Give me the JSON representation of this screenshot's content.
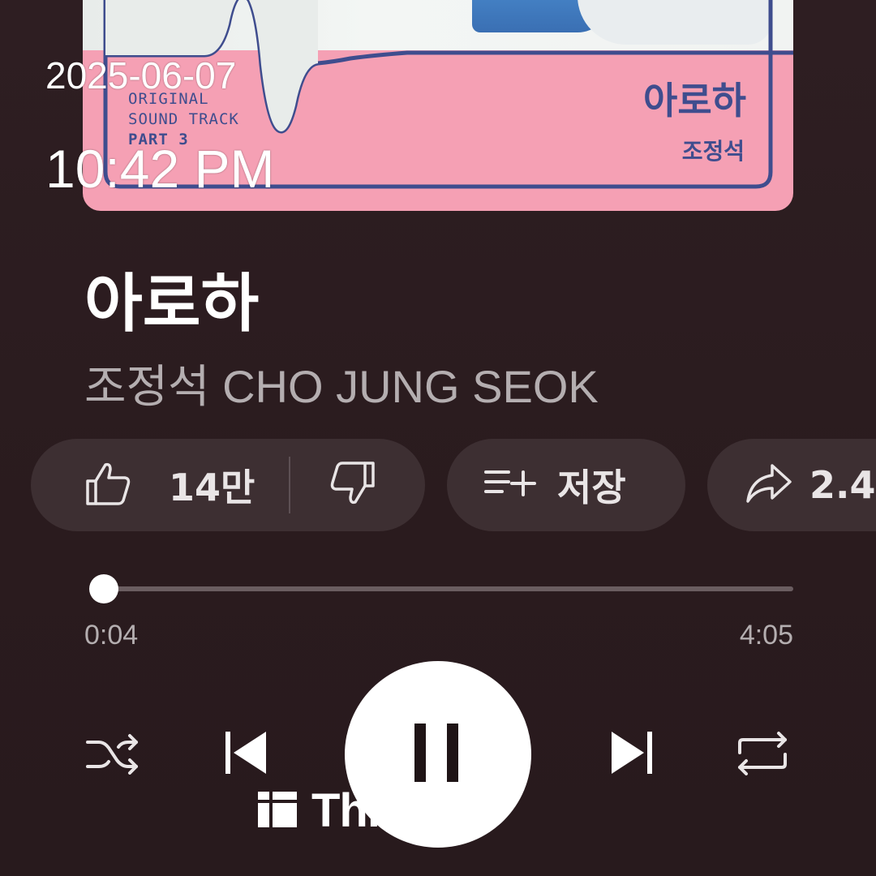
{
  "overlay": {
    "date": "2025-06-07",
    "time": "10:42 PM"
  },
  "album_art": {
    "ost_lines": [
      "ORIGINAL",
      "SOUND TRACK",
      "PART 3"
    ],
    "title": "아로하",
    "artist": "조정석",
    "colors": {
      "background": "#f5a0b4",
      "line": "#3f4d8e"
    }
  },
  "song": {
    "title": "아로하",
    "artist": "조정석 CHO JUNG SEOK"
  },
  "actions": {
    "like_count": "14만",
    "save_label": "저장",
    "share_label": "2.4"
  },
  "progress": {
    "current": "0:04",
    "total": "4:05",
    "fraction": 0.016
  },
  "controls": {
    "icons": [
      "shuffle-icon",
      "previous-icon",
      "pause-icon",
      "next-icon",
      "repeat-icon"
    ]
  },
  "watermark": {
    "text": "Threads"
  }
}
